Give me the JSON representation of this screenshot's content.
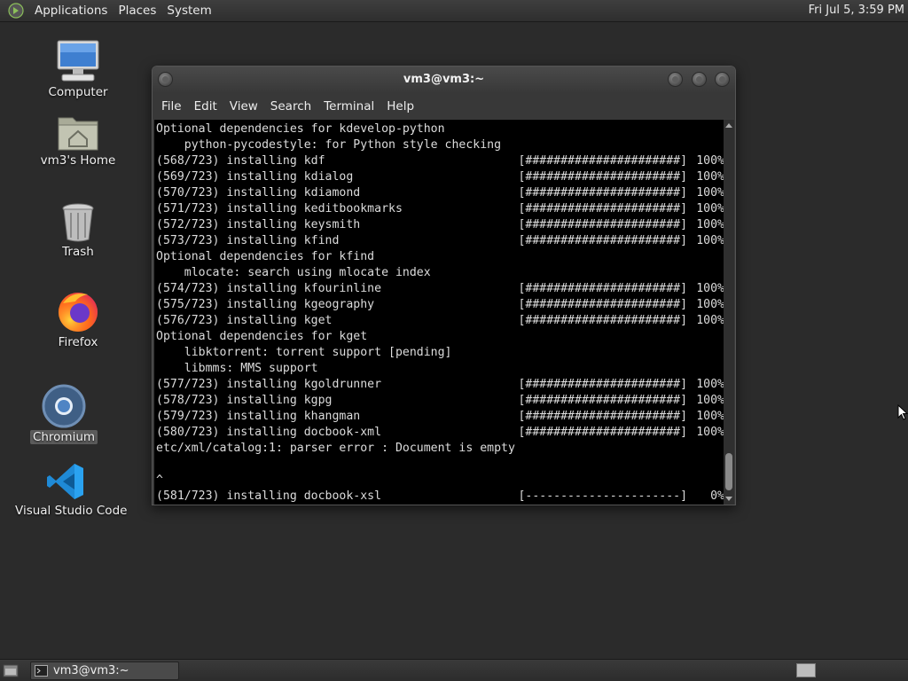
{
  "top_panel": {
    "menus": [
      "Applications",
      "Places",
      "System"
    ],
    "clock": "Fri Jul  5,  3:59 PM"
  },
  "desktop": {
    "icons": [
      {
        "label": "Computer",
        "icon": "computer-icon"
      },
      {
        "label": "vm3's Home",
        "icon": "home-folder-icon"
      },
      {
        "label": "Trash",
        "icon": "trash-icon"
      },
      {
        "label": "Firefox",
        "icon": "firefox-icon"
      },
      {
        "label": "Chromium",
        "icon": "chromium-icon",
        "selected": true
      },
      {
        "label": "Visual Studio Code",
        "icon": "vscode-icon"
      }
    ]
  },
  "terminal": {
    "title": "vm3@vm3:~",
    "menu": [
      "File",
      "Edit",
      "View",
      "Search",
      "Terminal",
      "Help"
    ],
    "lines": [
      {
        "text": "Optional dependencies for kdevelop-python"
      },
      {
        "text": "    python-pycodestyle: for Python style checking"
      },
      {
        "pkg": "(568/723) installing kdf",
        "bar": "[######################]",
        "pct": "100%"
      },
      {
        "pkg": "(569/723) installing kdialog",
        "bar": "[######################]",
        "pct": "100%"
      },
      {
        "pkg": "(570/723) installing kdiamond",
        "bar": "[######################]",
        "pct": "100%"
      },
      {
        "pkg": "(571/723) installing keditbookmarks",
        "bar": "[######################]",
        "pct": "100%"
      },
      {
        "pkg": "(572/723) installing keysmith",
        "bar": "[######################]",
        "pct": "100%"
      },
      {
        "pkg": "(573/723) installing kfind",
        "bar": "[######################]",
        "pct": "100%"
      },
      {
        "text": "Optional dependencies for kfind"
      },
      {
        "text": "    mlocate: search using mlocate index"
      },
      {
        "pkg": "(574/723) installing kfourinline",
        "bar": "[######################]",
        "pct": "100%"
      },
      {
        "pkg": "(575/723) installing kgeography",
        "bar": "[######################]",
        "pct": "100%"
      },
      {
        "pkg": "(576/723) installing kget",
        "bar": "[######################]",
        "pct": "100%"
      },
      {
        "text": "Optional dependencies for kget"
      },
      {
        "text": "    libktorrent: torrent support [pending]"
      },
      {
        "text": "    libmms: MMS support"
      },
      {
        "pkg": "(577/723) installing kgoldrunner",
        "bar": "[######################]",
        "pct": "100%"
      },
      {
        "pkg": "(578/723) installing kgpg",
        "bar": "[######################]",
        "pct": "100%"
      },
      {
        "pkg": "(579/723) installing khangman",
        "bar": "[######################]",
        "pct": "100%"
      },
      {
        "pkg": "(580/723) installing docbook-xml",
        "bar": "[######################]",
        "pct": "100%"
      },
      {
        "text": "etc/xml/catalog:1: parser error : Document is empty"
      },
      {
        "text": ""
      },
      {
        "text": "^"
      },
      {
        "pkg": "(581/723) installing docbook-xsl",
        "bar": "[----------------------]",
        "pct": "0%"
      }
    ]
  },
  "taskbar": {
    "task_label": "vm3@vm3:~"
  }
}
